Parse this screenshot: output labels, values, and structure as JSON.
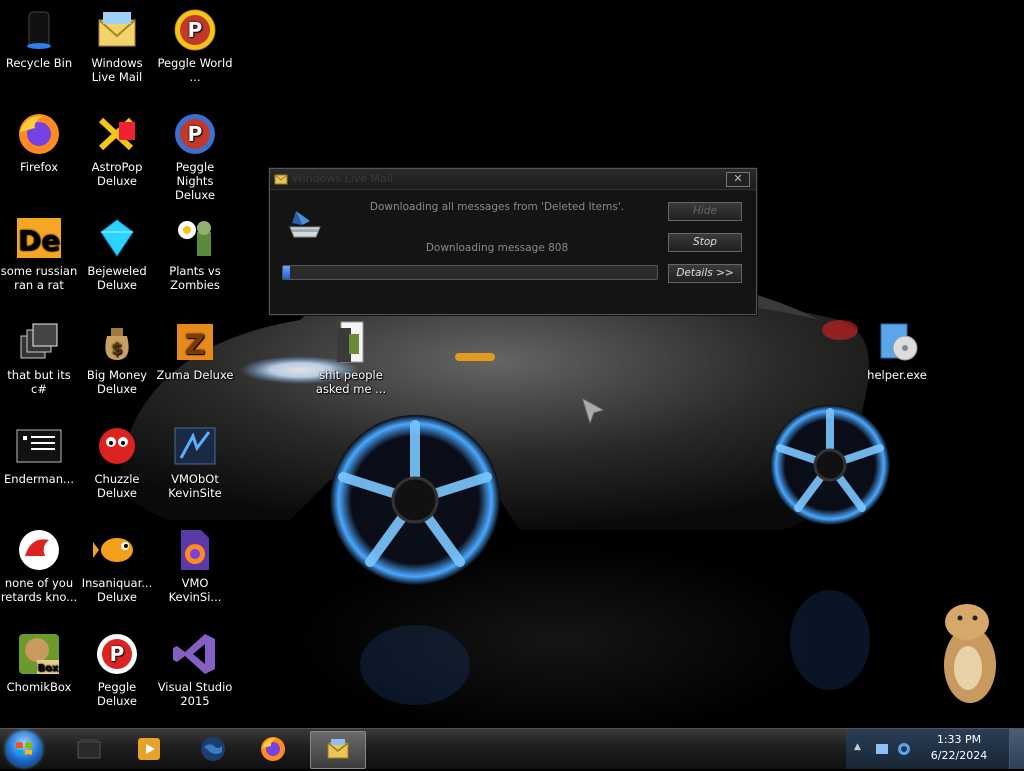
{
  "desktop": {
    "icons": [
      {
        "label": "Recycle Bin",
        "icon": "recycle-bin-icon"
      },
      {
        "label": "Windows Live Mail",
        "icon": "windows-live-mail-icon"
      },
      {
        "label": "Peggle World ...",
        "icon": "peggle-world-icon"
      },
      {
        "label": "Firefox",
        "icon": "firefox-icon"
      },
      {
        "label": "AstroPop Deluxe",
        "icon": "astropop-icon"
      },
      {
        "label": "Peggle Nights Deluxe",
        "icon": "peggle-nights-icon"
      },
      {
        "label": "some russian ran a rat",
        "icon": "de-icon"
      },
      {
        "label": "Bejeweled Deluxe",
        "icon": "bejeweled-icon"
      },
      {
        "label": "Plants vs Zombies",
        "icon": "plants-vs-zombies-icon"
      },
      {
        "label": "that but its c#",
        "icon": "windows-stack-icon"
      },
      {
        "label": "Big Money Deluxe",
        "icon": "money-bag-icon"
      },
      {
        "label": "Zuma Deluxe",
        "icon": "zuma-icon"
      },
      {
        "label": "shit people asked me ...",
        "icon": "folder-icon"
      },
      {
        "label": "helper.exe",
        "icon": "installer-icon"
      },
      {
        "label": "Enderman...",
        "icon": "console-icon"
      },
      {
        "label": "Chuzzle Deluxe",
        "icon": "chuzzle-icon"
      },
      {
        "label": "VMObOt KevinSite",
        "icon": "vmobot-icon"
      },
      {
        "label": "none of you retards kno...",
        "icon": "dragon-icon"
      },
      {
        "label": "Insaniquar... Deluxe",
        "icon": "fish-icon"
      },
      {
        "label": "VMO KevinSi...",
        "icon": "firefox-file-icon"
      },
      {
        "label": "ChomikBox",
        "icon": "chomikbox-icon"
      },
      {
        "label": "Peggle Deluxe",
        "icon": "peggle-icon"
      },
      {
        "label": "Visual Studio 2015",
        "icon": "visual-studio-icon"
      }
    ]
  },
  "dialog": {
    "title": "Windows Live Mail",
    "status_line1": "Downloading all messages from 'Deleted Items'.",
    "status_line2": "Downloading message 808",
    "progress": 0.02,
    "buttons": {
      "hide": "Hide",
      "stop": "Stop",
      "details": "Details >>"
    },
    "close_glyph": "✕"
  },
  "taskbar": {
    "items": [
      "explorer-icon",
      "media-player-icon",
      "globe-icon",
      "firefox-icon",
      "windows-live-mail-icon"
    ],
    "tray": {
      "chevron": "▲",
      "time": "1:33 PM",
      "date": "6/22/2024"
    }
  },
  "colors": {
    "accent_blue": "#1d5fd6",
    "taskbar_dark": "#101010",
    "tray_blue": "#1f3247"
  }
}
